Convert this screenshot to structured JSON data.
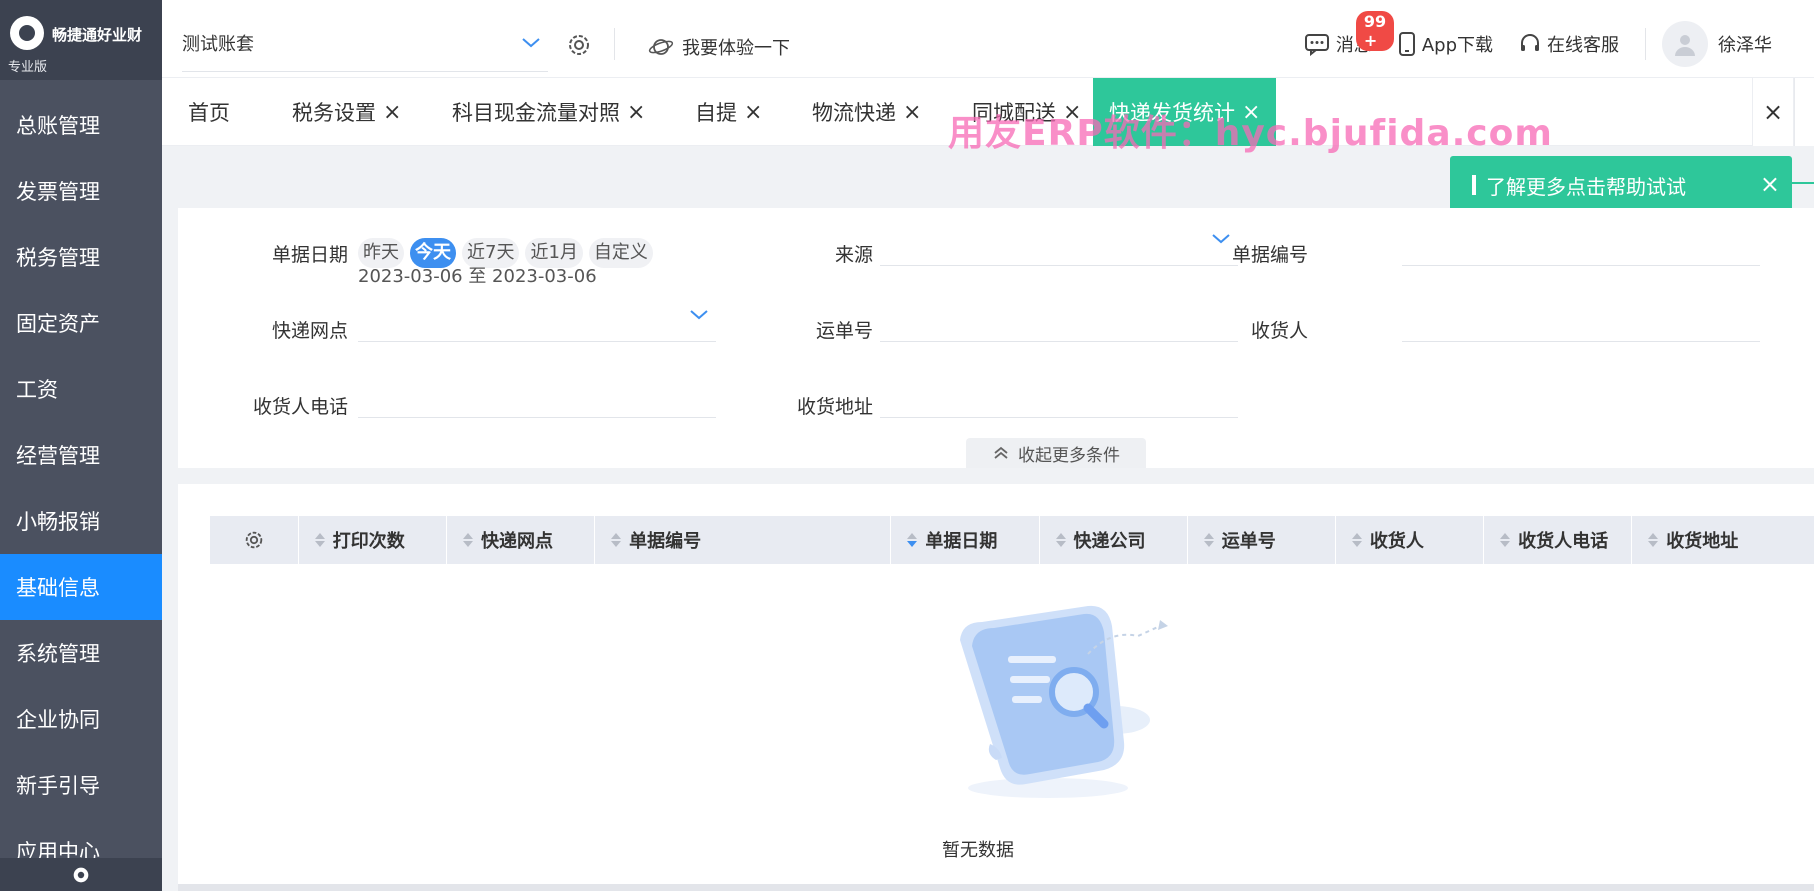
{
  "brand": {
    "name": "畅捷通好业财",
    "edition": "专业版"
  },
  "sidebar": {
    "items": [
      {
        "label": "总账管理"
      },
      {
        "label": "发票管理"
      },
      {
        "label": "税务管理"
      },
      {
        "label": "固定资产"
      },
      {
        "label": "工资"
      },
      {
        "label": "经营管理"
      },
      {
        "label": "小畅报销"
      },
      {
        "label": "基础信息",
        "active": true
      },
      {
        "label": "系统管理"
      },
      {
        "label": "企业协同"
      },
      {
        "label": "新手引导"
      },
      {
        "label": "应用中心"
      }
    ]
  },
  "header": {
    "account": "测试账套",
    "trial": "我要体验一下",
    "messages_label": "消息",
    "messages_badge": "99 +",
    "app_download": "App下载",
    "online_service": "在线客服",
    "username": "徐泽华"
  },
  "tabs": [
    {
      "label": "首页",
      "closable": false
    },
    {
      "label": "税务设置",
      "closable": true
    },
    {
      "label": "科目现金流量对照",
      "closable": true
    },
    {
      "label": "自提",
      "closable": true
    },
    {
      "label": "物流快递",
      "closable": true
    },
    {
      "label": "同城配送",
      "closable": true
    },
    {
      "label": "快递发货统计",
      "closable": true,
      "active": true
    }
  ],
  "tab_close_glyph": "×",
  "watermark": "用友ERP软件：hyc.bjufida.com",
  "help_notice": "了解更多点击帮助试试",
  "filters": {
    "date_label": "单据日期",
    "date_options": [
      "昨天",
      "今天",
      "近7天",
      "近1月",
      "自定义"
    ],
    "date_selected": "今天",
    "date_range": "2023-03-06 至 2023-03-06",
    "source_label": "来源",
    "doc_no_label": "单据编号",
    "outlet_label": "快递网点",
    "waybill_label": "运单号",
    "receiver_label": "收货人",
    "receiver_phone_label": "收货人电话",
    "address_label": "收货地址",
    "collapse_label": "收起更多条件"
  },
  "table": {
    "columns": [
      "打印次数",
      "快递网点",
      "单据编号",
      "单据日期",
      "快递公司",
      "运单号",
      "收货人",
      "收货人电话",
      "收货地址"
    ],
    "empty_text": "暂无数据"
  },
  "colors": {
    "sidebar_bg": "#4b5160",
    "active_menu": "#1a8cff",
    "active_tab": "#2ec79a",
    "badge": "#f04a45",
    "watermark": "#f76ab6"
  }
}
